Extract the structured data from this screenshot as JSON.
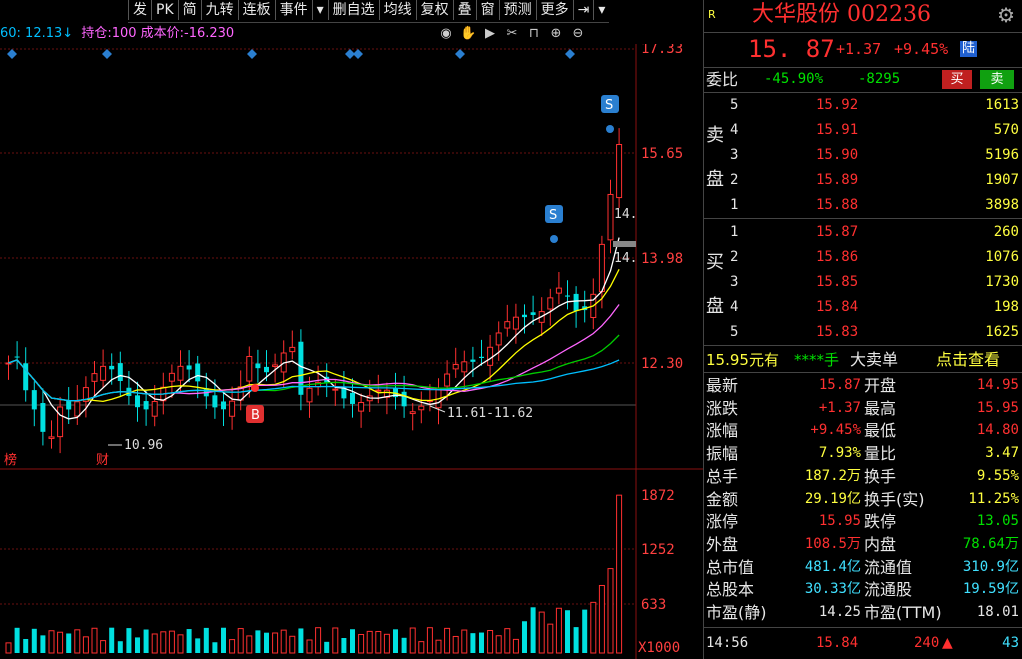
{
  "toolbar": {
    "items": [
      "发",
      "PK",
      "简",
      "九转",
      "连板",
      "事件",
      "▾",
      "删自选",
      "均线",
      "复权",
      "叠",
      "窗",
      "预测",
      "更多",
      "⇥",
      "▾"
    ]
  },
  "chart_header": {
    "ma_text": "60: 12.13↓",
    "position_text": "持仓:100 成本价:-16.230"
  },
  "price_axis": [
    "17.33",
    "15.65",
    "13.98",
    "12.30"
  ],
  "volume_axis": [
    "1872",
    "1252",
    "633",
    "X1000"
  ],
  "annotations": {
    "low_price": "10.96",
    "gap_range": "11.61-11.62",
    "price_tag1": "14.",
    "price_tag2": "14.",
    "mark_bang": "榜",
    "mark_cai": "财",
    "buy_marker": "B",
    "sell_marker": "S"
  },
  "quote": {
    "market_tag": "R",
    "name_code": "大华股份 002236",
    "price": "15. 87",
    "change": "+1.37",
    "change_pct": "+9.45%",
    "lu_tag": "陆",
    "weibi_label": "委比",
    "weibi_pct": "-45.90%",
    "weibi_diff": "-8295",
    "buy_btn": "买",
    "sell_btn": "卖"
  },
  "ask_label": [
    "卖",
    "盘"
  ],
  "bid_label": [
    "买",
    "盘"
  ],
  "asks": [
    {
      "level": "5",
      "price": "15.92",
      "vol": "1613"
    },
    {
      "level": "4",
      "price": "15.91",
      "vol": "570"
    },
    {
      "level": "3",
      "price": "15.90",
      "vol": "5196"
    },
    {
      "level": "2",
      "price": "15.89",
      "vol": "1907"
    },
    {
      "level": "1",
      "price": "15.88",
      "vol": "3898"
    }
  ],
  "bids": [
    {
      "level": "1",
      "price": "15.87",
      "vol": "260"
    },
    {
      "level": "2",
      "price": "15.86",
      "vol": "1076"
    },
    {
      "level": "3",
      "price": "15.85",
      "vol": "1730"
    },
    {
      "level": "4",
      "price": "15.84",
      "vol": "198"
    },
    {
      "level": "5",
      "price": "15.83",
      "vol": "1625"
    }
  ],
  "big_order": {
    "price_text": "15.95元有",
    "stars": "****手",
    "big_sell": "大卖单",
    "link": "点击查看"
  },
  "stats": [
    {
      "l1": "最新",
      "v1": "15.87",
      "c1": "red",
      "l2": "开盘",
      "v2": "14.95",
      "c2": "red"
    },
    {
      "l1": "涨跌",
      "v1": "+1.37",
      "c1": "red",
      "l2": "最高",
      "v2": "15.95",
      "c2": "red"
    },
    {
      "l1": "涨幅",
      "v1": "+9.45%",
      "c1": "red",
      "l2": "最低",
      "v2": "14.80",
      "c2": "red"
    },
    {
      "l1": "振幅",
      "v1": "7.93%",
      "c1": "yellow",
      "l2": "量比",
      "v2": "3.47",
      "c2": "yellow"
    },
    {
      "l1": "总手",
      "v1": "187.2万",
      "c1": "yellow",
      "l2": "换手",
      "v2": "9.55%",
      "c2": "yellow"
    },
    {
      "l1": "金额",
      "v1": "29.19亿",
      "c1": "yellow",
      "l2": "换手(实)",
      "v2": "11.25%",
      "c2": "yellow"
    },
    {
      "l1": "涨停",
      "v1": "15.95",
      "c1": "red",
      "l2": "跌停",
      "v2": "13.05",
      "c2": "green"
    },
    {
      "l1": "外盘",
      "v1": "108.5万",
      "c1": "red",
      "l2": "内盘",
      "v2": "78.64万",
      "c2": "green"
    },
    {
      "l1": "总市值",
      "v1": "481.4亿",
      "c1": "cyan",
      "l2": "流通值",
      "v2": "310.9亿",
      "c2": "cyan"
    },
    {
      "l1": "总股本",
      "v1": "30.33亿",
      "c1": "cyan",
      "l2": "流通股",
      "v2": "19.59亿",
      "c2": "cyan"
    },
    {
      "l1": "市盈(静)",
      "v1": "14.25",
      "c1": "white",
      "l2": "市盈(TTM)",
      "v2": "18.01",
      "c2": "white"
    }
  ],
  "tick": {
    "time": "14:56",
    "price": "15.84",
    "vol": "240",
    "arrow": "▲",
    "count": "43"
  },
  "colors": {
    "up": "#ff3030",
    "down": "#00e0e0",
    "ma5": "#ffffff",
    "ma10": "#ffff00",
    "ma20": "#ff66ff",
    "ma30": "#00cc00",
    "ma60": "#00bfff"
  }
}
